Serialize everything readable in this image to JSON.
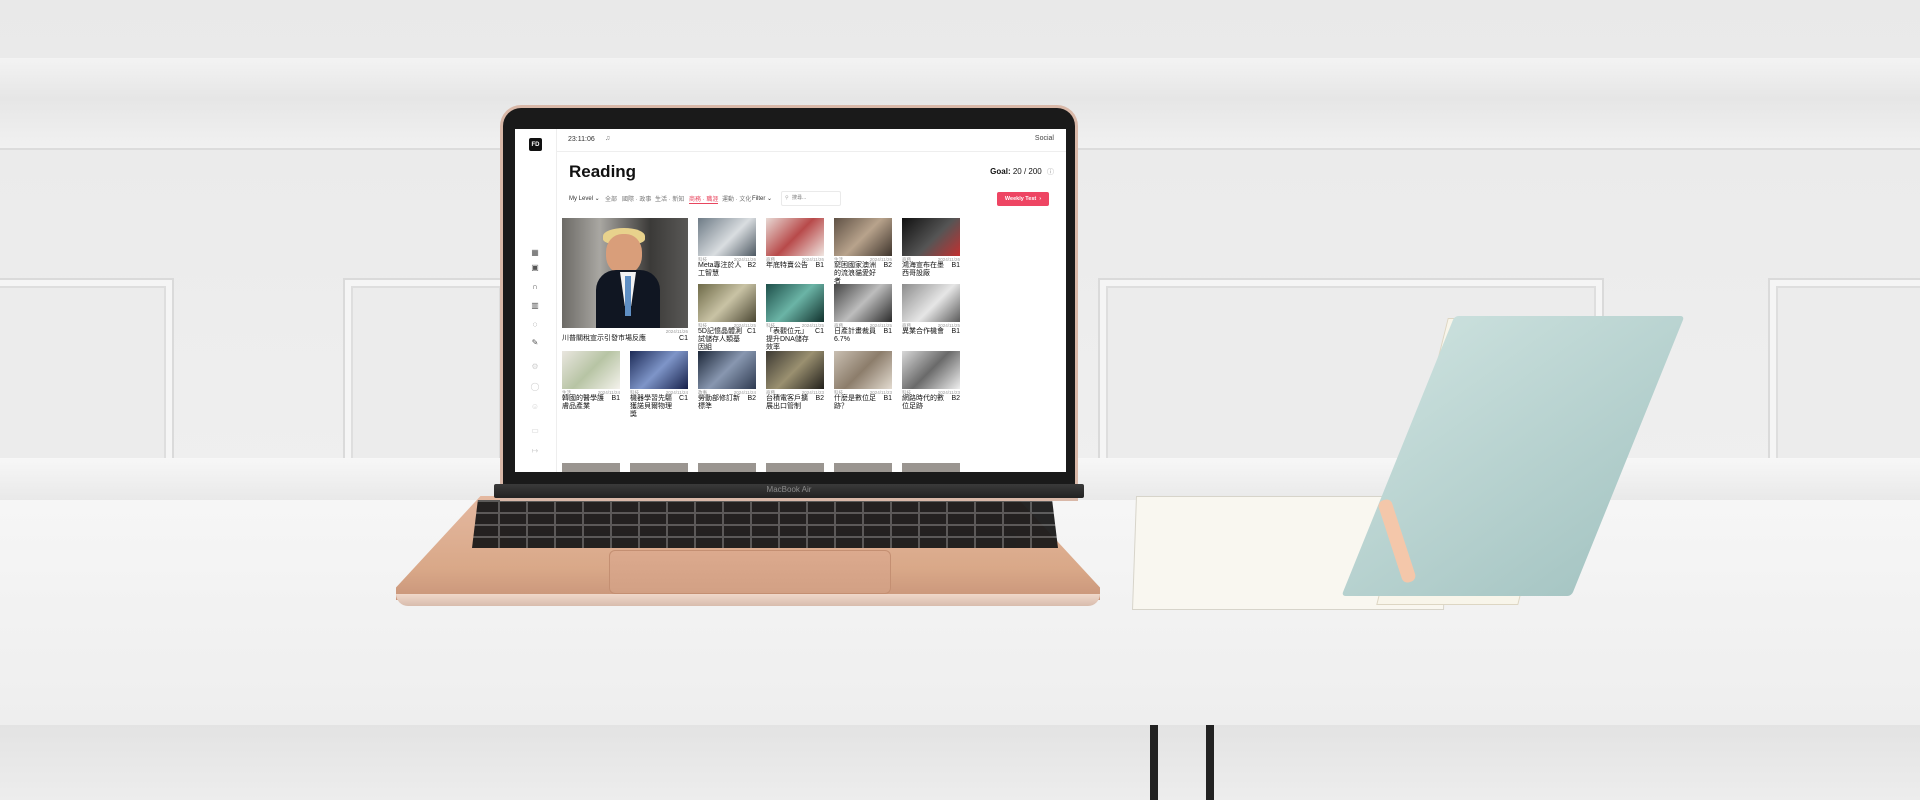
{
  "laptop": {
    "model_label": "MacBook Air"
  },
  "app": {
    "logo_text": "FD",
    "clock": "23:11:06",
    "social_label": "Social",
    "page_title": "Reading",
    "goal": {
      "label": "Goal:",
      "value": "20 / 200"
    },
    "filters": {
      "level_label": "My Level",
      "tabs": [
        {
          "label": "全部",
          "active": false
        },
        {
          "label": "國際 · 政事",
          "active": false
        },
        {
          "label": "生活 · 新知",
          "active": false
        },
        {
          "label": "商務 · 職涯",
          "active": true
        },
        {
          "label": "運動 · 文化",
          "active": false
        }
      ],
      "filter_label": "Filter",
      "search_placeholder": "搜尋..."
    },
    "weekly_test_label": "Weekly Test",
    "colors": {
      "accent": "#ee4563",
      "text": "#111111",
      "muted": "#999999"
    },
    "sidebar_icons": [
      "grid-icon",
      "book-icon",
      "headphones-icon",
      "reader-icon",
      "chat-icon",
      "pencil-icon",
      "settings-icon",
      "help-icon",
      "profile-icon",
      "bookmark-icon",
      "logout-icon"
    ],
    "feature_article": {
      "title": "川普關稅宣示引發市場反應",
      "level": "C1",
      "date": "2024/11/26"
    },
    "articles": [
      {
        "title": "Meta專注於人工智慧",
        "level": "B2",
        "meta": "科技",
        "date": "2024/11/26"
      },
      {
        "title": "年底特賣公告",
        "level": "B1",
        "meta": "商務",
        "date": "2024/11/26"
      },
      {
        "title": "窮困國家澳洲的流浪貓愛好者",
        "level": "B2",
        "meta": "生活",
        "date": "2024/11/26"
      },
      {
        "title": "鴻海宣布在墨西哥設廠",
        "level": "B1",
        "meta": "商務",
        "date": "2024/11/26"
      },
      {
        "title": "5D記憶晶體測試儲存人類基因組",
        "level": "C1",
        "meta": "科技",
        "date": "2024/11/25"
      },
      {
        "title": "「表觀位元」提升DNA儲存效率",
        "level": "C1",
        "meta": "科技",
        "date": "2024/11/25"
      },
      {
        "title": "日產計畫裁員6.7%",
        "level": "B1",
        "meta": "商務",
        "date": "2024/11/25"
      },
      {
        "title": "異業合作機會",
        "level": "B1",
        "meta": "商務",
        "date": "2024/11/25"
      },
      {
        "title": "韓國的醫學護膚品產業",
        "level": "B1",
        "meta": "生活",
        "date": "2024/11/24"
      },
      {
        "title": "機器學習先驅獲諾貝爾物理獎",
        "level": "C1",
        "meta": "科技",
        "date": "2024/11/24"
      },
      {
        "title": "勞動部修訂新標準",
        "level": "B2",
        "meta": "政事",
        "date": "2024/11/24"
      },
      {
        "title": "台積電客戶擴展出口管制",
        "level": "B2",
        "meta": "商務",
        "date": "2024/11/23"
      },
      {
        "title": "什麼是數位足跡？",
        "level": "B1",
        "meta": "科技",
        "date": "2024/11/23"
      },
      {
        "title": "網路時代的數位足跡",
        "level": "B2",
        "meta": "科技",
        "date": "2024/11/23"
      }
    ]
  }
}
